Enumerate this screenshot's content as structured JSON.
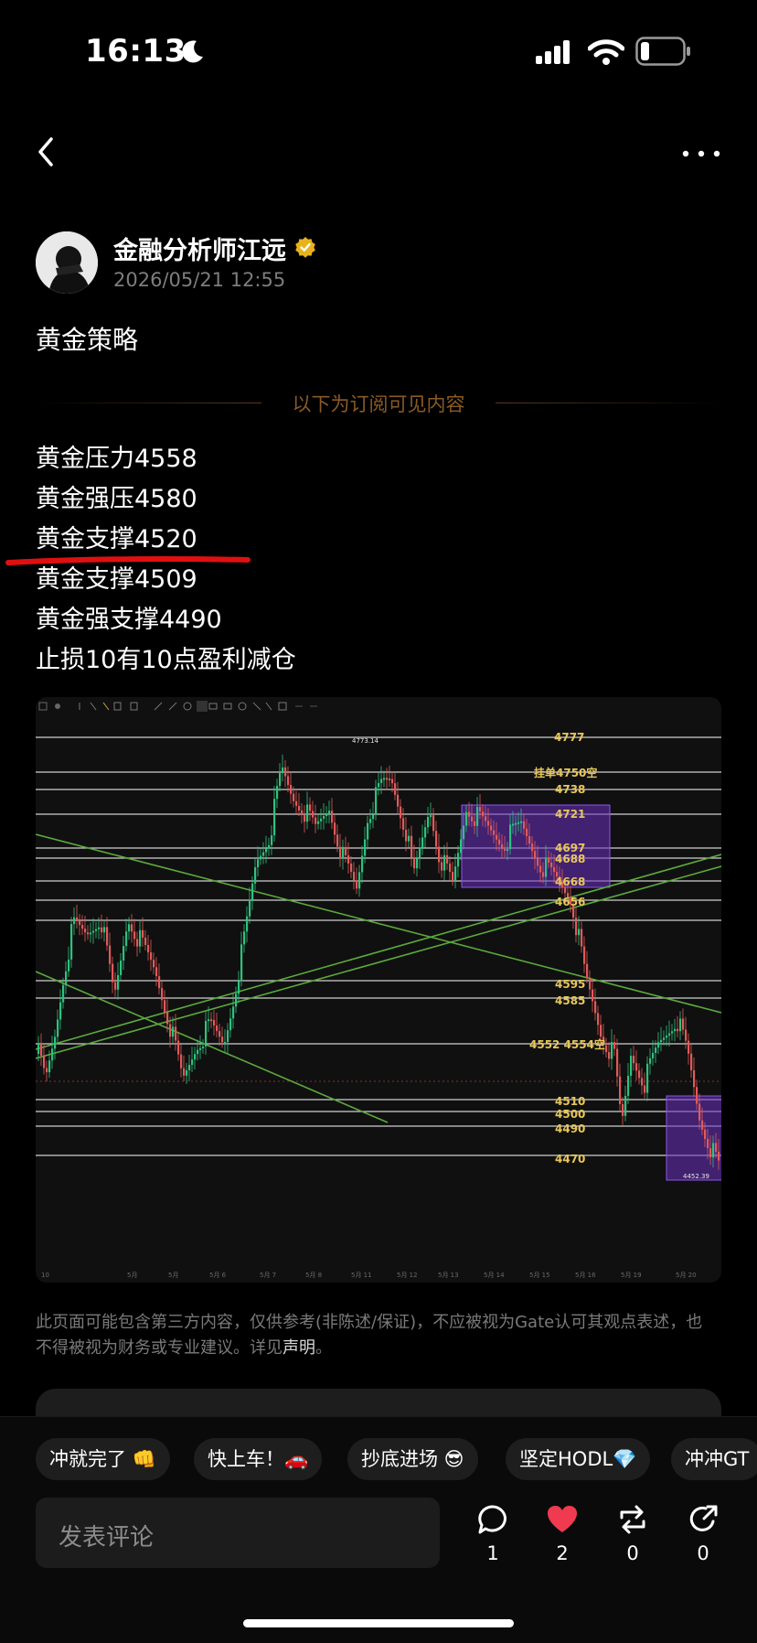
{
  "status_bar": {
    "time": "16:13"
  },
  "post": {
    "author": "金融分析师江远",
    "timestamp": "2026/05/21 12:55",
    "title": "黄金策略",
    "subscriber_divider": "以下为订阅可见内容",
    "lines": [
      "黄金压力4558",
      "黄金强压4580",
      "黄金支撑4520",
      "黄金支撑4509",
      "黄金强支撑4490",
      "止损10有10点盈利减仓"
    ]
  },
  "chart_data": {
    "type": "line",
    "title": "",
    "level_labels": [
      "4777",
      "挂单4750空",
      "4738",
      "4721",
      "4697",
      "4688",
      "4668",
      "4656",
      "4595",
      "4585",
      "4552 4554空",
      "4510",
      "4500",
      "4490",
      "4470"
    ],
    "annotations": [
      "4773.14",
      "4452.39"
    ],
    "x_tick_labels": [
      "10",
      "5月",
      "5月",
      "5月 6",
      "5月 7",
      "5月 8",
      "5月 11",
      "5月 12",
      "5月 13",
      "5月 14",
      "5月 15",
      "5月 16",
      "5月 19",
      "5月 20"
    ],
    "colors": {
      "candle_up": "#2ec27e",
      "candle_down": "#e05a5a",
      "level_label": "#e8c75a",
      "trendline": "#5ba93c",
      "zone": "#6a2fc0"
    }
  },
  "disclaimer": {
    "text": "此页面可能包含第三方内容，仅供参考(非陈述/保证)，不应被视为Gate认可其观点表述，也不得被视为财务或专业建议。详见",
    "link": "声明",
    "end": "。"
  },
  "quick_replies": [
    "冲就完了 👊",
    "快上车！🚗",
    "抄底进场 😎",
    "坚定HODL💎",
    "冲冲GT"
  ],
  "comment": {
    "placeholder": "发表评论"
  },
  "actions": {
    "comments": "1",
    "likes": "2",
    "reposts": "0",
    "shares": "0"
  },
  "icons": [
    "back-arrow-icon",
    "more-dots-icon",
    "verified-badge-icon",
    "comment-bubble-icon",
    "heart-icon",
    "repost-icon",
    "share-icon"
  ]
}
